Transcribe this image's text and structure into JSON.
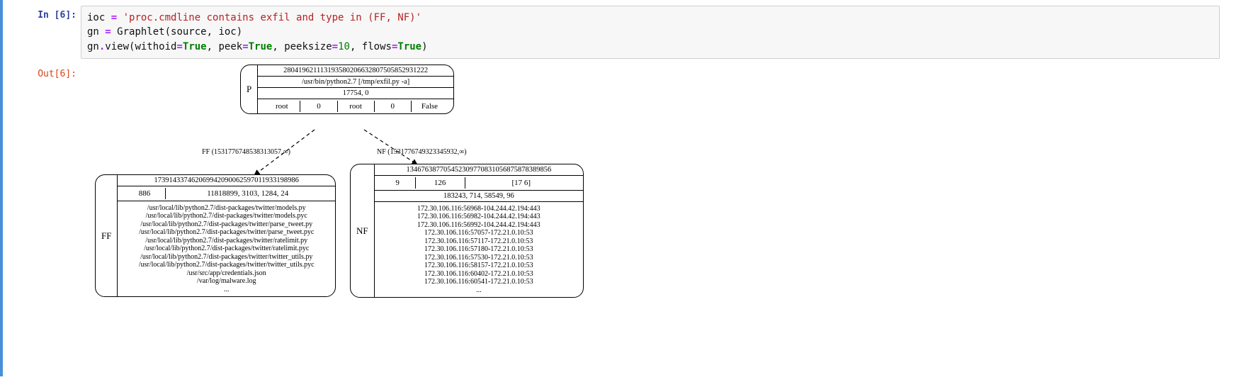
{
  "cell_in_prompt": "In [6]:",
  "cell_out_prompt": "Out[6]:",
  "code": {
    "l1_var": "ioc ",
    "l1_eq": "=",
    "l1_str": " 'proc.cmdline contains exfil and type in (FF, NF)'",
    "l2_var": "gn ",
    "l2_eq": "=",
    "l2_call": " Graphlet(source, ioc)",
    "l3_a": "gn",
    "l3_b": ".",
    "l3_c": "view(withoid",
    "l3_eq1": "=",
    "l3_true1": "True",
    "l3_d": ", peek",
    "l3_eq2": "=",
    "l3_true2": "True",
    "l3_e": ", peeksize",
    "l3_eq3": "=",
    "l3_num": "10",
    "l3_f": ", flows",
    "l3_eq4": "=",
    "l3_true3": "True",
    "l3_g": ")"
  },
  "edges": {
    "ff_label": "FF (1531776748538313057,∞)",
    "nf_label": "NF (1531776749323345932,∞)"
  },
  "nodeP": {
    "label": "P",
    "oid": "280419621113193580206632807505852931222",
    "cmd": "/usr/bin/python2.7 [/tmp/exfil.py -a]",
    "pid": "17754, 0",
    "cols": [
      "root",
      "0",
      "root",
      "0",
      "False"
    ]
  },
  "nodeFF": {
    "label": "FF",
    "oid": "173914337462069942090062597011933198986",
    "cols": [
      "886",
      "11818899, 3103, 1284, 24"
    ],
    "files": [
      "/usr/local/lib/python2.7/dist-packages/twitter/models.py",
      "/usr/local/lib/python2.7/dist-packages/twitter/models.pyc",
      "/usr/local/lib/python2.7/dist-packages/twitter/parse_tweet.py",
      "/usr/local/lib/python2.7/dist-packages/twitter/parse_tweet.pyc",
      "/usr/local/lib/python2.7/dist-packages/twitter/ratelimit.py",
      "/usr/local/lib/python2.7/dist-packages/twitter/ratelimit.pyc",
      "/usr/local/lib/python2.7/dist-packages/twitter/twitter_utils.py",
      "/usr/local/lib/python2.7/dist-packages/twitter/twitter_utils.pyc",
      "/usr/src/app/credentials.json",
      "/var/log/malware.log",
      "..."
    ]
  },
  "nodeNF": {
    "label": "NF",
    "oid": "134676387705452309770831056875878389856",
    "cols": [
      "9",
      "126",
      "[17 6]"
    ],
    "stats": "183243, 714, 58549, 96",
    "flows": [
      "172.30.106.116:56968-104.244.42.194:443",
      "172.30.106.116:56982-104.244.42.194:443",
      "172.30.106.116:56992-104.244.42.194:443",
      "172.30.106.116:57057-172.21.0.10:53",
      "172.30.106.116:57117-172.21.0.10:53",
      "172.30.106.116:57180-172.21.0.10:53",
      "172.30.106.116:57530-172.21.0.10:53",
      "172.30.106.116:58157-172.21.0.10:53",
      "172.30.106.116:60402-172.21.0.10:53",
      "172.30.106.116:60541-172.21.0.10:53",
      "..."
    ]
  }
}
